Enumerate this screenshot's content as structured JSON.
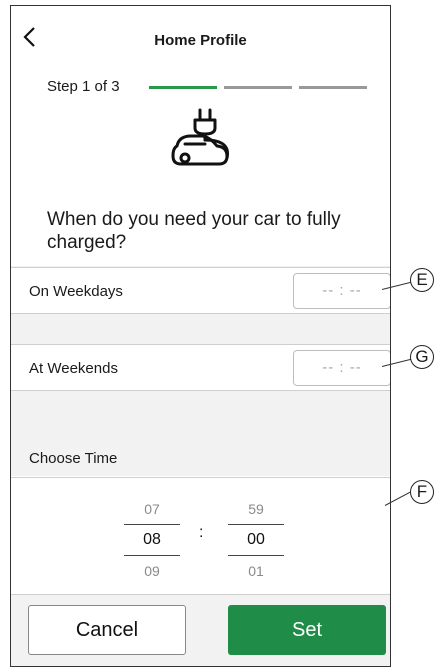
{
  "header": {
    "title": "Home Profile",
    "back_icon": "chevron-left-icon"
  },
  "steps": {
    "label": "Step 1 of 3",
    "total": 3,
    "current": 1,
    "active_color": "#2a9a4a"
  },
  "hero_icon": "ev-charging-car-icon",
  "question": "When do you need your car to fully charged?",
  "weekdays": {
    "label": "On Weekdays",
    "value": "-- : --"
  },
  "weekends": {
    "label": "At Weekends",
    "value": "-- : --"
  },
  "choose_time": {
    "label": "Choose Time",
    "hours": {
      "prev": "07",
      "selected": "08",
      "next": "09"
    },
    "separator": ":",
    "minutes": {
      "prev": "59",
      "selected": "00",
      "next": "01"
    }
  },
  "footer": {
    "cancel_label": "Cancel",
    "set_label": "Set",
    "set_color": "#1f8c48"
  },
  "callouts": {
    "e": "E",
    "g": "G",
    "f": "F"
  }
}
